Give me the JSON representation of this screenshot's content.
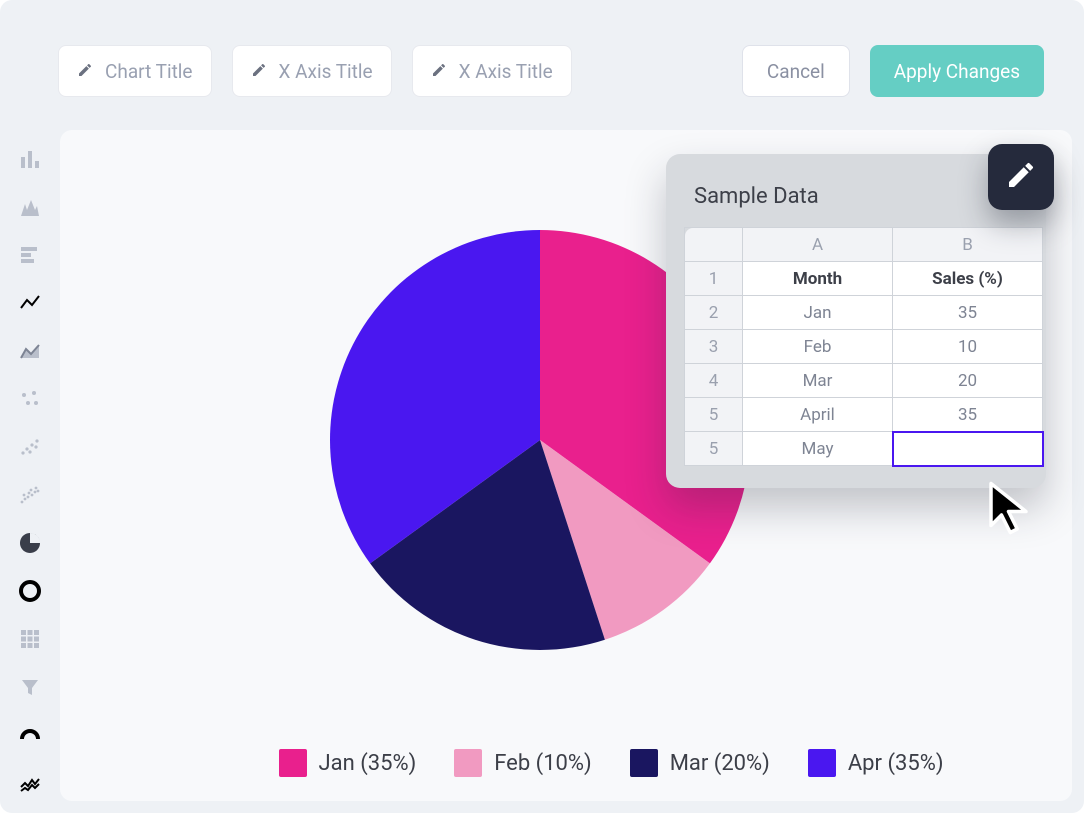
{
  "toolbar": {
    "chart_title_placeholder": "Chart Title",
    "x_axis1_placeholder": "X Axis Title",
    "x_axis2_placeholder": "X Axis Title",
    "cancel_label": "Cancel",
    "apply_label": "Apply Changes"
  },
  "sidebar": {
    "items": [
      {
        "name": "bar-chart-icon"
      },
      {
        "name": "column-chart-icon"
      },
      {
        "name": "horizontal-bar-icon"
      },
      {
        "name": "line-chart-icon"
      },
      {
        "name": "area-chart-icon"
      },
      {
        "name": "scatter-sparse-icon"
      },
      {
        "name": "scatter-medium-icon"
      },
      {
        "name": "scatter-dense-icon"
      },
      {
        "name": "pie-chart-icon"
      },
      {
        "name": "donut-chart-icon"
      },
      {
        "name": "heatmap-icon"
      },
      {
        "name": "funnel-icon"
      },
      {
        "name": "gauge-icon"
      },
      {
        "name": "sparkline-icon"
      }
    ],
    "active": 8
  },
  "panel": {
    "title": "Sample Data",
    "columns": [
      "A",
      "B"
    ],
    "rows": [
      {
        "num": "1",
        "a": "Month",
        "b": "Sales (%)",
        "header": true
      },
      {
        "num": "2",
        "a": "Jan",
        "b": "35"
      },
      {
        "num": "3",
        "a": "Feb",
        "b": "10"
      },
      {
        "num": "4",
        "a": "Mar",
        "b": "20"
      },
      {
        "num": "5",
        "a": "April",
        "b": "35"
      },
      {
        "num": "5",
        "a": "May",
        "b": "",
        "active_b": true
      }
    ]
  },
  "chart_data": {
    "type": "pie",
    "title": "",
    "categories": [
      "Jan",
      "Feb",
      "Mar",
      "Apr"
    ],
    "values": [
      35,
      10,
      20,
      35
    ],
    "colors": {
      "Jan": "#e9208d",
      "Feb": "#f19ac1",
      "Mar": "#1a1660",
      "Apr": "#4a17f0"
    },
    "legend_labels": [
      "Jan (35%)",
      "Feb (10%)",
      "Mar (20%)",
      "Apr (35%)"
    ]
  }
}
